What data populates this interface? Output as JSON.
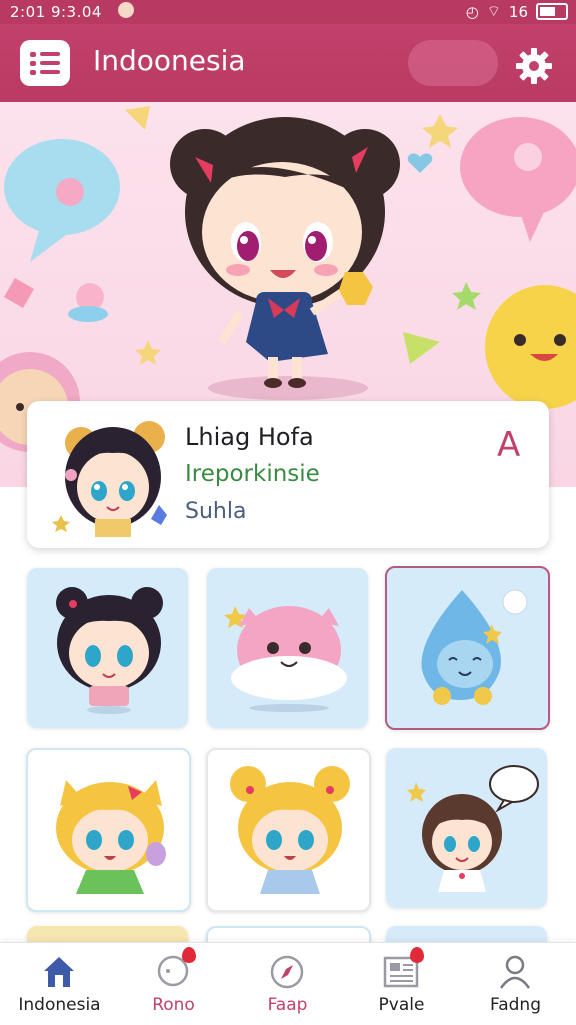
{
  "status_bar": {
    "time": "2:01 9:3.04",
    "signal_text": "16"
  },
  "header": {
    "title": "Indoonesia"
  },
  "profile": {
    "name": "Lhiag Hofa",
    "subtitle": "Ireporkinsie",
    "tag": "Suhla",
    "badge_letter": "A"
  },
  "nav": {
    "items": [
      {
        "label": "Indonesia",
        "icon": "home-icon",
        "active": true
      },
      {
        "label": "Rono",
        "icon": "bubble-icon",
        "badge": true
      },
      {
        "label": "Faap",
        "icon": "compass-icon",
        "badge": false
      },
      {
        "label": "Pvale",
        "icon": "newspaper-icon",
        "badge": true
      },
      {
        "label": "Fadng",
        "icon": "profile-icon",
        "badge": false
      }
    ]
  },
  "colors": {
    "accent": "#c2416c",
    "tile_bg": "#d6ebfa",
    "green": "#3b8a43"
  }
}
